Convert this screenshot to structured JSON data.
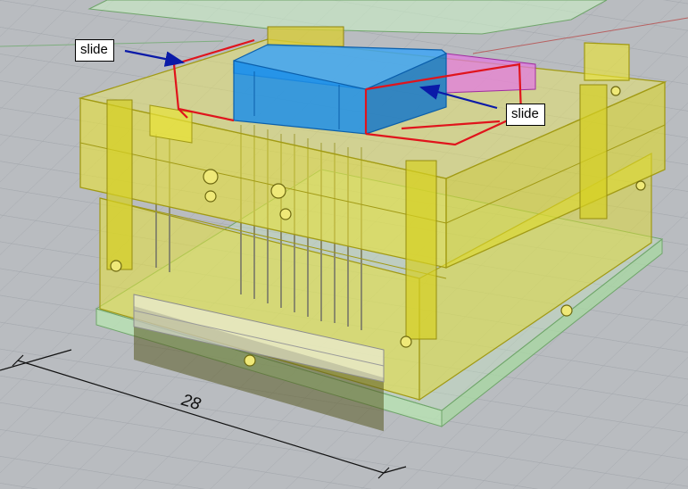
{
  "annotations": {
    "left_callout": "slide",
    "right_callout": "slide"
  },
  "dimension": {
    "value": "28"
  },
  "colors": {
    "viewport_bg": "#b9bcc0",
    "grid": "#a4a8ad",
    "mold_yellow": "#e8e23a",
    "slide_blue": "#1e8fe8",
    "core_pink": "#e27ae0",
    "base_green": "#b8e6b2",
    "outline_red": "#e0141c",
    "arrow_navy": "#0a1aa8"
  }
}
